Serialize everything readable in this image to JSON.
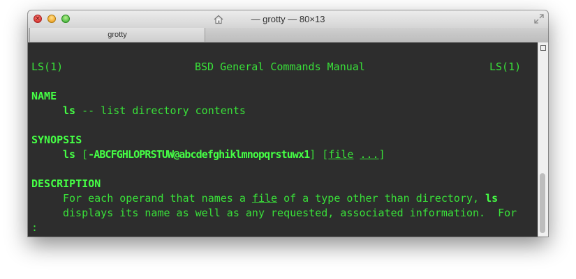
{
  "window": {
    "title": "— grotty — 80×13",
    "tab_label": "grotty"
  },
  "icons": {
    "close": "close-traffic-light",
    "minimize": "minimize-traffic-light",
    "zoom": "zoom-traffic-light",
    "home": "home-icon",
    "fullscreen": "fullscreen-arrows-icon"
  },
  "colors": {
    "terminal_bg": "#2d2d2d",
    "terminal_fg": "#39e139"
  },
  "man": {
    "header_left": "LS(1)",
    "header_center": "BSD General Commands Manual",
    "header_right": "LS(1)",
    "name_heading": "NAME",
    "name_cmd": "ls",
    "name_desc": " -- list directory contents",
    "synopsis_heading": "SYNOPSIS",
    "syn_cmd": "ls",
    "syn_open": " [",
    "syn_flags": "-ABCFGHLOPRSTUW@abcdefghiklmnopqrstuwx1",
    "syn_mid": "] [",
    "syn_file": "file",
    "syn_space": " ",
    "syn_ellipsis": "...",
    "syn_close": "]",
    "description_heading": "DESCRIPTION",
    "desc1_a": "For each operand that names a ",
    "desc1_file": "file",
    "desc1_b": " of a type other than directory, ",
    "desc1_ls": "ls",
    "desc2": "displays its name as well as any requested, associated information.  For",
    "prompt": ":"
  },
  "scrollbar": {
    "position": 0.72
  }
}
